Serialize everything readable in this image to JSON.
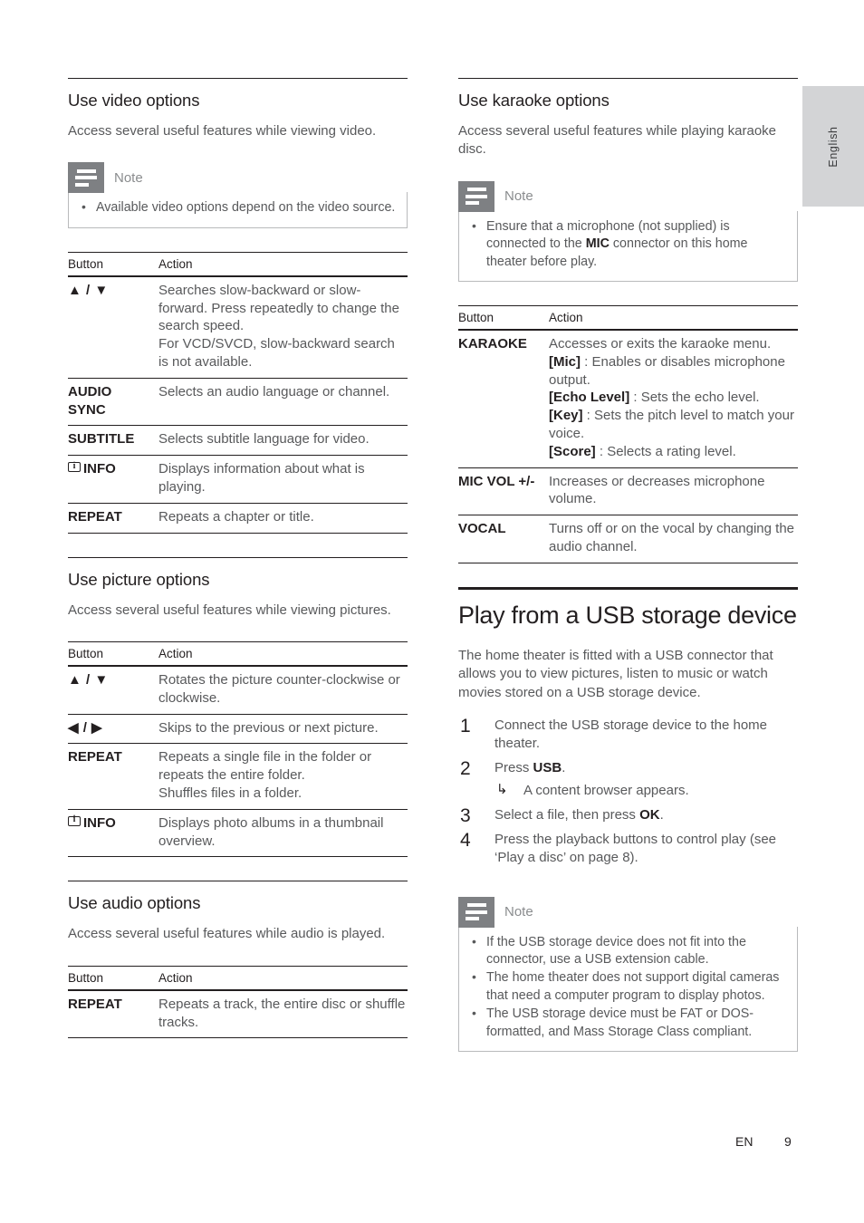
{
  "page": {
    "language_tab": "English",
    "footer_locale": "EN",
    "footer_page": "9"
  },
  "left_column": {
    "video": {
      "heading": "Use video options",
      "intro": "Access several useful features while viewing video.",
      "note": {
        "label": "Note",
        "items": [
          "Available video options depend on the video source."
        ]
      },
      "table": {
        "headers": [
          "Button",
          "Action"
        ],
        "rows": [
          {
            "button": "▲ / ▼",
            "action": "Searches slow-backward or slow-forward. Press repeatedly to change the search speed.\nFor VCD/SVCD, slow-backward search is not available."
          },
          {
            "button": "AUDIO SYNC",
            "action": "Selects an audio language or channel."
          },
          {
            "button": "SUBTITLE",
            "action": "Selects subtitle language for video."
          },
          {
            "button": "INFO",
            "button_icon": "info-icon",
            "action": "Displays information about what is playing."
          },
          {
            "button": "REPEAT",
            "action": "Repeats a chapter or title."
          }
        ]
      }
    },
    "picture": {
      "heading": "Use picture options",
      "intro": "Access several useful features while viewing pictures.",
      "table": {
        "headers": [
          "Button",
          "Action"
        ],
        "rows": [
          {
            "button": "▲ / ▼",
            "action": "Rotates the picture counter-clockwise or clockwise."
          },
          {
            "button": "◀ / ▶",
            "action": "Skips to the previous or next picture."
          },
          {
            "button": "REPEAT",
            "action": "Repeats a single file in the folder or repeats the entire folder.\nShuffles files in a folder."
          },
          {
            "button": "INFO",
            "button_icon": "info-icon",
            "action": "Displays photo albums in a thumbnail overview."
          }
        ]
      }
    },
    "audio": {
      "heading": "Use audio options",
      "intro": "Access several useful features while audio is played.",
      "table": {
        "headers": [
          "Button",
          "Action"
        ],
        "rows": [
          {
            "button": "REPEAT",
            "action": "Repeats a track, the entire disc or shuffle tracks."
          }
        ]
      }
    }
  },
  "right_column": {
    "karaoke": {
      "heading": "Use karaoke options",
      "intro": "Access several useful features while playing karaoke disc.",
      "note": {
        "label": "Note",
        "items_html": [
          "Ensure that a microphone (not supplied) is connected to the <b>MIC</b> connector on this home theater before play."
        ]
      },
      "table": {
        "headers": [
          "Button",
          "Action"
        ],
        "rows": [
          {
            "button": "KARAOKE",
            "action_html": "Accesses or exits the karaoke menu.<br><b>[Mic]</b> : Enables or disables microphone output.<br><b>[Echo Level]</b> : Sets the echo level.<br><b>[Key]</b> : Sets the pitch level to match your voice.<br><b>[Score]</b> : Selects a rating level."
          },
          {
            "button": "MIC VOL +/-",
            "action_html": "Increases or decreases microphone volume."
          },
          {
            "button": "VOCAL",
            "action_html": "Turns off or on the vocal by changing the audio channel."
          }
        ]
      }
    },
    "usb": {
      "heading": "Play from a USB storage device",
      "intro": "The home theater is fitted with a USB connector that allows you to view pictures, listen to music or watch movies stored on a USB storage device.",
      "steps": [
        {
          "num": "1",
          "text_html": "Connect the USB storage device to the home theater."
        },
        {
          "num": "2",
          "text_html": "Press <b>USB</b>.",
          "substep": "A content browser appears."
        },
        {
          "num": "3",
          "text_html": "Select a file, then press <b>OK</b>."
        },
        {
          "num": "4",
          "text_html": "Press the playback buttons to control play (see ‘Play a disc’ on page 8)."
        }
      ],
      "note": {
        "label": "Note",
        "items_html": [
          "If the USB storage device does not fit into the connector, use a USB extension cable.",
          "The home theater does not support digital cameras that need a computer program to display photos.",
          "The USB storage device must be FAT or DOS-formatted, and Mass Storage Class compliant."
        ]
      }
    }
  },
  "colors": {
    "ink": "#231f20",
    "body_text": "#58595b",
    "note_icon_bg": "#7e8083",
    "tab_bg": "#d3d4d6"
  }
}
